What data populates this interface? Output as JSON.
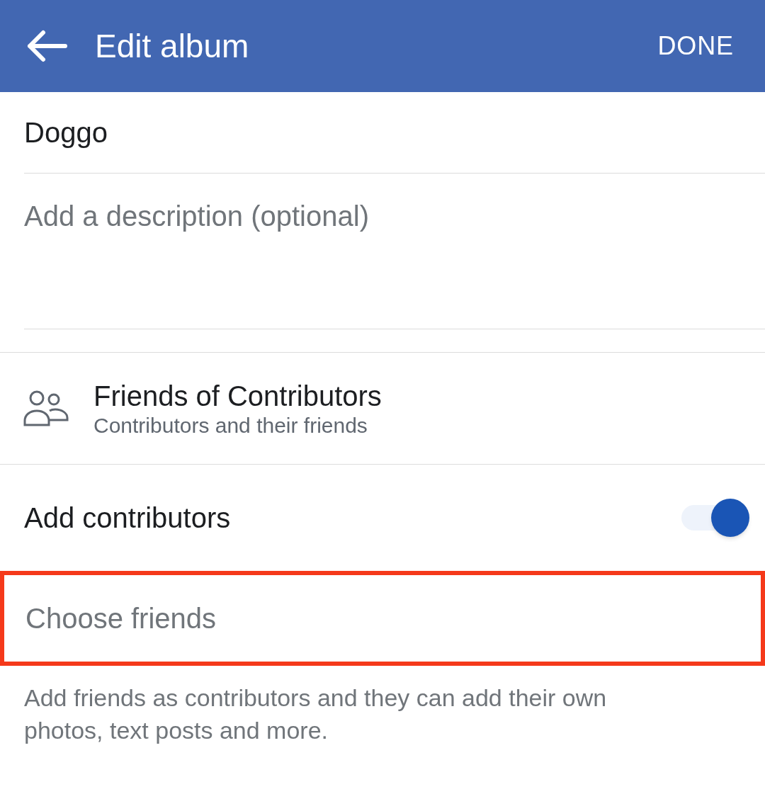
{
  "header": {
    "title": "Edit album",
    "action": "DONE"
  },
  "album_name": {
    "value": "Doggo"
  },
  "description": {
    "placeholder": "Add a description (optional)"
  },
  "audience": {
    "title": "Friends of Contributors",
    "subtitle": "Contributors and their friends"
  },
  "contributors": {
    "label": "Add contributors",
    "on": true
  },
  "choose_friends": {
    "placeholder": "Choose friends",
    "highlighted": true
  },
  "help_text": "Add friends as contributors and they can add their own photos, text posts and more."
}
